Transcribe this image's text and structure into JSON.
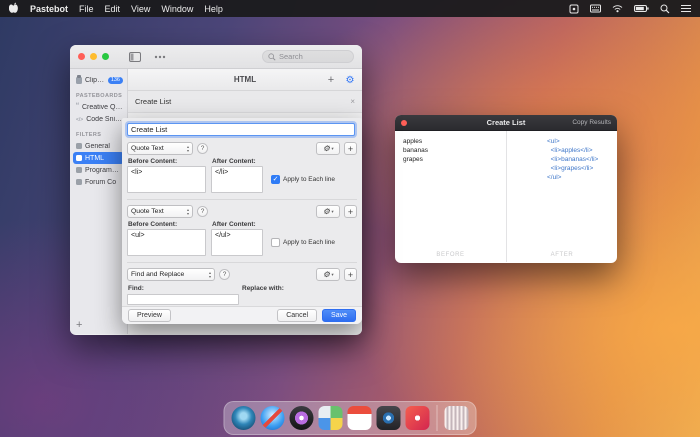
{
  "menu_bar": {
    "app_name": "Pastebot",
    "menus": [
      "File",
      "Edit",
      "View",
      "Window",
      "Help"
    ],
    "status_icons": [
      "bartender-icon",
      "keyboard-icon",
      "wifi-icon",
      "battery-icon",
      "spotlight-icon",
      "notification-center-icon"
    ]
  },
  "main_window": {
    "search_placeholder": "Search",
    "sidebar": {
      "clipboard_label": "Clipboard",
      "clipboard_badge": "136",
      "pasteboards_title": "PASTEBOARDS",
      "pasteboards": [
        "Creative Quotes",
        "Code Snippets"
      ],
      "filters_title": "FILTERS",
      "filters": [
        "General",
        "HTML",
        "Programming",
        "Forum Co"
      ],
      "add_label": "+"
    },
    "list_pane": {
      "title": "HTML",
      "add_label": "+",
      "rows": [
        "Create List"
      ]
    }
  },
  "sheet": {
    "name_value": "Create List",
    "help_label": "?",
    "add_label": "+",
    "filters": [
      {
        "type": "Quote Text",
        "before_label": "Before Content:",
        "after_label": "After Content:",
        "before": "<li>",
        "after": "</li>",
        "apply_label": "Apply to Each line",
        "state": "checked"
      },
      {
        "type": "Quote Text",
        "before_label": "Before Content:",
        "after_label": "After Content:",
        "before": "<ul>",
        "after": "</ul>",
        "apply_label": "Apply to Each line",
        "state": "unchecked"
      },
      {
        "type": "Find and Replace",
        "find_label": "Find:",
        "replace_label": "Replace with:"
      }
    ],
    "footer": {
      "preview": "Preview",
      "cancel": "Cancel",
      "save": "Save"
    }
  },
  "preview_window": {
    "title": "Create List",
    "copy_button": "Copy Results",
    "before_lines": [
      "apples",
      "bananas",
      "grapes"
    ],
    "after_lines": [
      "<ul>",
      "  <li>apples</li>",
      "  <li>bananas</li>",
      "  <li>grapes</li>",
      "</ul>"
    ],
    "before_caption": "BEFORE",
    "after_caption": "AFTER"
  },
  "dock": {
    "apps": [
      "Time Machine",
      "Safari",
      "iTunes",
      "Maps",
      "Calendar",
      "Photo Booth",
      "Music",
      "Trash"
    ]
  },
  "colors": {
    "accent": "#3478f6",
    "selection_blue": "#3b80f5",
    "code_blue": "#3f77c9"
  }
}
